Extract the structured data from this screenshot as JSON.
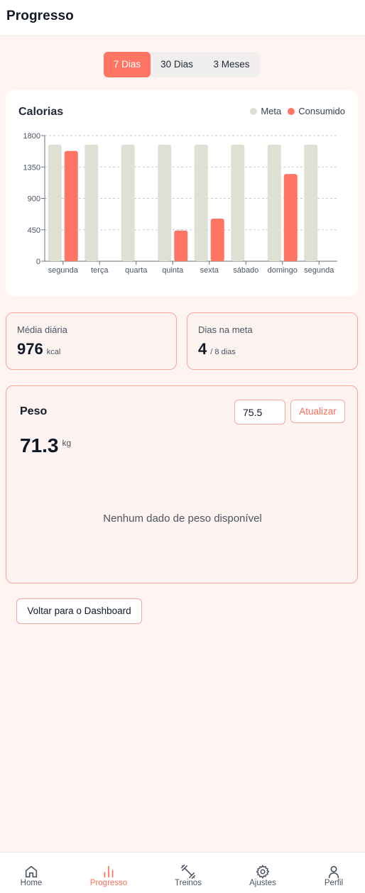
{
  "header": {
    "title": "Progresso"
  },
  "range_tabs": [
    {
      "label": "7 Dias",
      "active": true
    },
    {
      "label": "30 Dias",
      "active": false
    },
    {
      "label": "3 Meses",
      "active": false
    }
  ],
  "colors": {
    "accent": "#ff7563",
    "goal_bar": "#dfe0d4",
    "card_border": "#f6a899"
  },
  "chart_data": {
    "type": "bar",
    "title": "Calorias",
    "categories": [
      "segunda",
      "terça",
      "quarta",
      "quinta",
      "sexta",
      "sábado",
      "domingo",
      "segunda"
    ],
    "series": [
      {
        "name": "Meta",
        "color": "#dfe0d4",
        "values": [
          1670,
          1670,
          1670,
          1670,
          1670,
          1670,
          1670,
          1670
        ]
      },
      {
        "name": "Consumido",
        "color": "#ff7563",
        "values": [
          1580,
          0,
          0,
          440,
          610,
          0,
          1250,
          0
        ]
      }
    ],
    "ylim": [
      0,
      1800
    ],
    "yticks": [
      0,
      450,
      900,
      1350,
      1800
    ],
    "grid": true,
    "legend": "top-right"
  },
  "stats": {
    "daily_avg": {
      "label": "Média diária",
      "value": "976",
      "unit": "kcal"
    },
    "goal_days": {
      "label": "Dias na meta",
      "value": "4",
      "unit": "/ 8 dias"
    }
  },
  "weight": {
    "title": "Peso",
    "input_value": "75.5",
    "update_label": "Atualizar",
    "current": "71.3",
    "unit": "kg",
    "empty_message": "Nenhum dado de peso disponível"
  },
  "back_button": "Voltar para o Dashboard",
  "nav": [
    {
      "label": "Home",
      "icon": "home-icon",
      "active": false
    },
    {
      "label": "Progresso",
      "icon": "bar-chart-icon",
      "active": true
    },
    {
      "label": "Treinos",
      "icon": "dumbbell-icon",
      "active": false
    },
    {
      "label": "Ajustes",
      "icon": "gear-icon",
      "active": false
    },
    {
      "label": "Perfil",
      "icon": "user-icon",
      "active": false
    }
  ]
}
